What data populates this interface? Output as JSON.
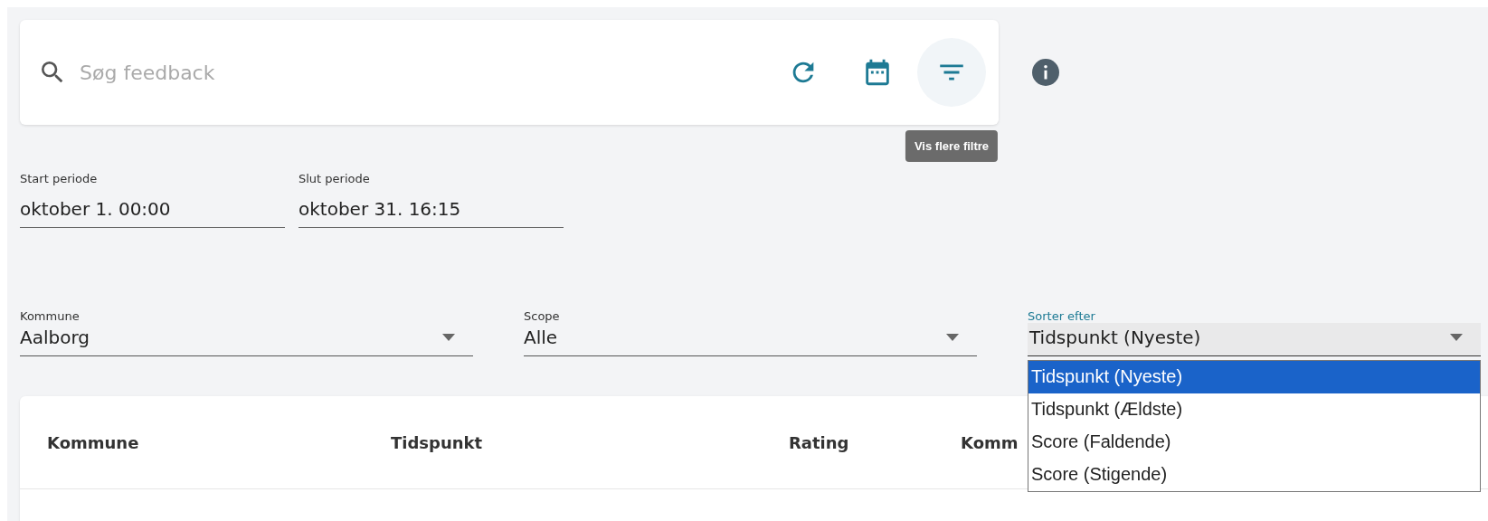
{
  "search": {
    "placeholder": "Søg feedback"
  },
  "toolbar": [
    {
      "kind": "refresh",
      "active": false
    },
    {
      "kind": "calendar",
      "active": false
    },
    {
      "kind": "filter",
      "active": true,
      "tooltip": "Vis flere filtre"
    }
  ],
  "date_fields": [
    {
      "label": "Start periode",
      "value": "oktober 1. 00:00"
    },
    {
      "label": "Slut periode",
      "value": "oktober 31. 16:15"
    }
  ],
  "select_fields": [
    {
      "label": "Kommune",
      "value": "Aalborg",
      "focused": false
    },
    {
      "label": "Scope",
      "value": "Alle",
      "focused": false
    },
    {
      "label": "Sorter efter",
      "value": "Tidspunkt (Nyeste)",
      "focused": true,
      "options": [
        {
          "label": "Tidspunkt (Nyeste)",
          "selected": true
        },
        {
          "label": "Tidspunkt (Ældste)",
          "selected": false
        },
        {
          "label": "Score (Faldende)",
          "selected": false
        },
        {
          "label": "Score (Stigende)",
          "selected": false
        }
      ]
    }
  ],
  "table": {
    "columns": [
      "Kommune",
      "Tidspunkt",
      "Rating",
      "Komm"
    ]
  }
}
